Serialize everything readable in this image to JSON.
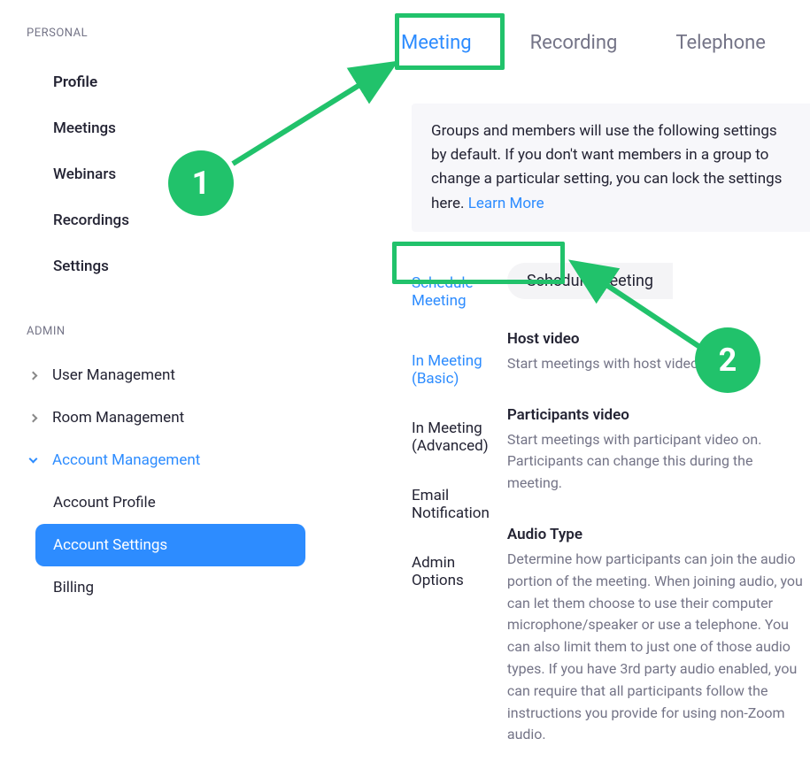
{
  "sidebar": {
    "personal_header": "PERSONAL",
    "personal_items": [
      "Profile",
      "Meetings",
      "Webinars",
      "Recordings",
      "Settings"
    ],
    "admin_header": "ADMIN",
    "admin_items": [
      {
        "label": "User Management",
        "expanded": false
      },
      {
        "label": "Room Management",
        "expanded": false
      },
      {
        "label": "Account Management",
        "expanded": true,
        "children": [
          "Account Profile",
          "Account Settings",
          "Billing"
        ],
        "active_child": 1
      }
    ]
  },
  "tabs": [
    "Meeting",
    "Recording",
    "Telephone"
  ],
  "active_tab": 0,
  "banner": {
    "text_part1": "Groups and members will use the following settings by default. If you don't want members in a group to change a particular setting, you can lock the settings here. ",
    "learn_more": "Learn More"
  },
  "subnav": [
    "Schedule Meeting",
    "In Meeting (Basic)",
    "In Meeting (Advanced)",
    "Email Notification",
    "Admin Options"
  ],
  "subnav_active": [
    0,
    1
  ],
  "pill": "Schedule Meeting",
  "settings": [
    {
      "title": "Host video",
      "desc": "Start meetings with host video on"
    },
    {
      "title": "Participants video",
      "desc": "Start meetings with participant video on. Participants can change this during the meeting."
    },
    {
      "title": "Audio Type",
      "desc": "Determine how participants can join the audio portion of the meeting. When joining audio, you can let them choose to use their computer microphone/speaker or use a telephone. You can also limit them to just one of those audio types. If you have 3rd party audio enabled, you can require that all participants follow the instructions you provide for using non-Zoom audio."
    }
  ],
  "annotations": {
    "one": "1",
    "two": "2"
  }
}
